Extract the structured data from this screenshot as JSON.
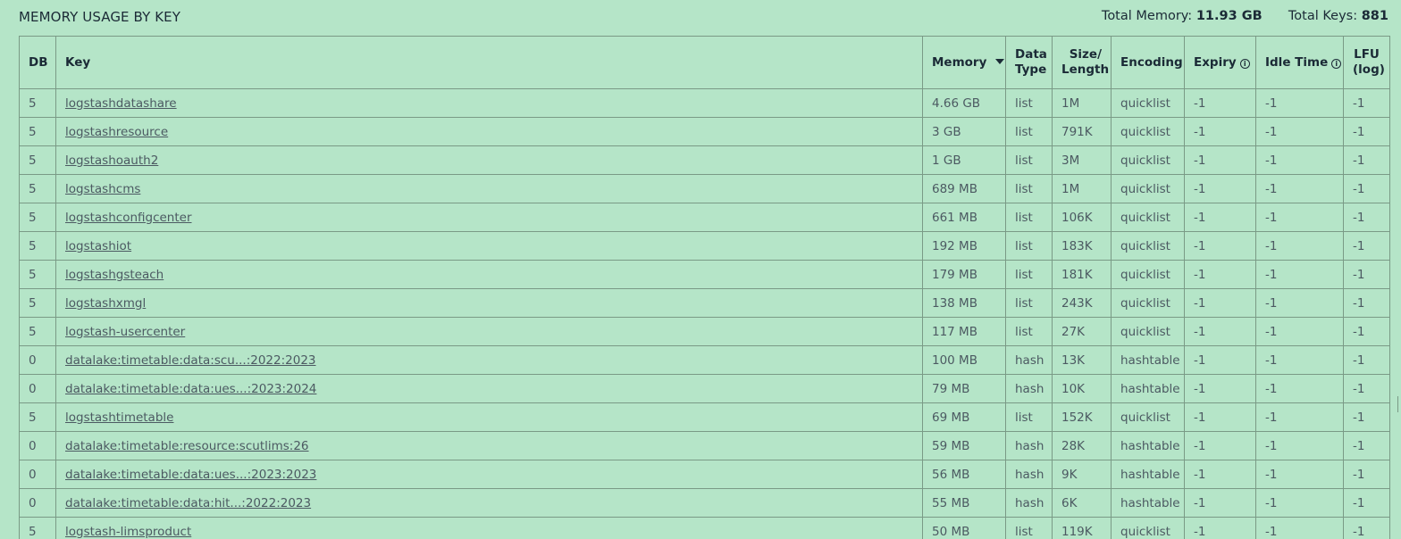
{
  "panel": {
    "title": "MEMORY USAGE BY KEY",
    "total_memory_label": "Total Memory:",
    "total_memory_value": "11.93 GB",
    "total_keys_label": "Total Keys:",
    "total_keys_value": "881"
  },
  "columns": {
    "db": "DB",
    "key": "Key",
    "memory": "Memory",
    "data_type_1": "Data",
    "data_type_2": "Type",
    "size_1": "Size/",
    "size_2": "Length",
    "encoding": "Encoding",
    "expiry": "Expiry",
    "idle_time": "Idle Time",
    "lfu_1": "LFU",
    "lfu_2": "(log)"
  },
  "rows": [
    {
      "db": "5",
      "key": "logstashdatashare",
      "memory": "4.66 GB",
      "type": "list",
      "size": "1M",
      "encoding": "quicklist",
      "expiry": "-1",
      "idle": "-1",
      "lfu": "-1"
    },
    {
      "db": "5",
      "key": "logstashresource",
      "memory": "3 GB",
      "type": "list",
      "size": "791K",
      "encoding": "quicklist",
      "expiry": "-1",
      "idle": "-1",
      "lfu": "-1"
    },
    {
      "db": "5",
      "key": "logstashoauth2",
      "memory": "1 GB",
      "type": "list",
      "size": "3M",
      "encoding": "quicklist",
      "expiry": "-1",
      "idle": "-1",
      "lfu": "-1"
    },
    {
      "db": "5",
      "key": "logstashcms",
      "memory": "689 MB",
      "type": "list",
      "size": "1M",
      "encoding": "quicklist",
      "expiry": "-1",
      "idle": "-1",
      "lfu": "-1"
    },
    {
      "db": "5",
      "key": "logstashconfigcenter",
      "memory": "661 MB",
      "type": "list",
      "size": "106K",
      "encoding": "quicklist",
      "expiry": "-1",
      "idle": "-1",
      "lfu": "-1"
    },
    {
      "db": "5",
      "key": "logstashiot",
      "memory": "192 MB",
      "type": "list",
      "size": "183K",
      "encoding": "quicklist",
      "expiry": "-1",
      "idle": "-1",
      "lfu": "-1"
    },
    {
      "db": "5",
      "key": "logstashgsteach",
      "memory": "179 MB",
      "type": "list",
      "size": "181K",
      "encoding": "quicklist",
      "expiry": "-1",
      "idle": "-1",
      "lfu": "-1"
    },
    {
      "db": "5",
      "key": "logstashxmgl",
      "memory": "138 MB",
      "type": "list",
      "size": "243K",
      "encoding": "quicklist",
      "expiry": "-1",
      "idle": "-1",
      "lfu": "-1"
    },
    {
      "db": "5",
      "key": "logstash-usercenter",
      "memory": "117 MB",
      "type": "list",
      "size": "27K",
      "encoding": "quicklist",
      "expiry": "-1",
      "idle": "-1",
      "lfu": "-1"
    },
    {
      "db": "0",
      "key": "datalake:timetable:data:scu...:2022:2023",
      "memory": "100 MB",
      "type": "hash",
      "size": "13K",
      "encoding": "hashtable",
      "expiry": "-1",
      "idle": "-1",
      "lfu": "-1"
    },
    {
      "db": "0",
      "key": "datalake:timetable:data:ues...:2023:2024",
      "memory": "79 MB",
      "type": "hash",
      "size": "10K",
      "encoding": "hashtable",
      "expiry": "-1",
      "idle": "-1",
      "lfu": "-1"
    },
    {
      "db": "5",
      "key": "logstashtimetable",
      "memory": "69 MB",
      "type": "list",
      "size": "152K",
      "encoding": "quicklist",
      "expiry": "-1",
      "idle": "-1",
      "lfu": "-1"
    },
    {
      "db": "0",
      "key": "datalake:timetable:resource:scutlims:26",
      "memory": "59 MB",
      "type": "hash",
      "size": "28K",
      "encoding": "hashtable",
      "expiry": "-1",
      "idle": "-1",
      "lfu": "-1"
    },
    {
      "db": "0",
      "key": "datalake:timetable:data:ues...:2023:2023",
      "memory": "56 MB",
      "type": "hash",
      "size": "9K",
      "encoding": "hashtable",
      "expiry": "-1",
      "idle": "-1",
      "lfu": "-1"
    },
    {
      "db": "0",
      "key": "datalake:timetable:data:hit...:2022:2023",
      "memory": "55 MB",
      "type": "hash",
      "size": "6K",
      "encoding": "hashtable",
      "expiry": "-1",
      "idle": "-1",
      "lfu": "-1"
    },
    {
      "db": "5",
      "key": "logstash-limsproduct",
      "memory": "50 MB",
      "type": "list",
      "size": "119K",
      "encoding": "quicklist",
      "expiry": "-1",
      "idle": "-1",
      "lfu": "-1"
    }
  ],
  "icons": {
    "sort": "sort-desc-icon",
    "info": "info-icon"
  },
  "colors": {
    "background": "#b5e5c8",
    "border": "#7a9a86",
    "text": "#1b2a36"
  }
}
